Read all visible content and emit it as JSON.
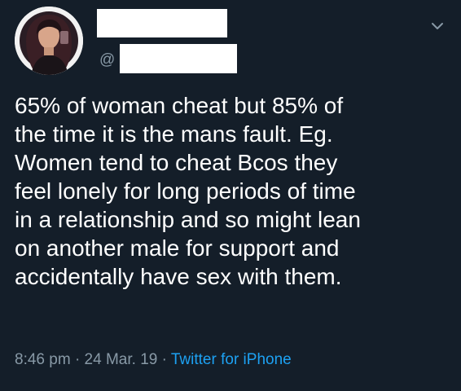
{
  "author": {
    "handle_prefix": "@",
    "avatar_icon": "profile-photo"
  },
  "tweet": {
    "text": "65% of woman cheat but 85% of\nthe time it is the mans fault. Eg.\nWomen tend to cheat Bcos they\nfeel lonely for long periods of time\nin a relationship and so might lean\non another male for support and\naccidentally have sex with them.",
    "time": "8:46 pm",
    "separator": "·",
    "date": "24 Mar. 19",
    "source": "Twitter for iPhone"
  },
  "icons": {
    "menu": "chevron-down-icon"
  },
  "colors": {
    "background": "#141e29",
    "text": "#ffffff",
    "muted": "#8899a6",
    "link": "#1da1f2"
  }
}
